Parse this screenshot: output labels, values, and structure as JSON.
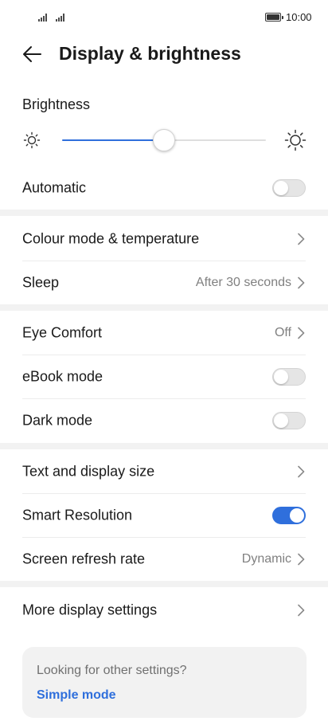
{
  "status_bar": {
    "time": "10:00"
  },
  "header": {
    "title": "Display & brightness"
  },
  "brightness": {
    "label": "Brightness",
    "level": 0.5
  },
  "settings": {
    "automatic": {
      "label": "Automatic",
      "enabled": false
    },
    "colour_mode": {
      "label": "Colour mode & temperature"
    },
    "sleep": {
      "label": "Sleep",
      "value": "After 30 seconds"
    },
    "eye_comfort": {
      "label": "Eye Comfort",
      "value": "Off"
    },
    "ebook_mode": {
      "label": "eBook mode",
      "enabled": false
    },
    "dark_mode": {
      "label": "Dark mode",
      "enabled": false
    },
    "text_display_size": {
      "label": "Text and display size"
    },
    "smart_resolution": {
      "label": "Smart Resolution",
      "enabled": true
    },
    "refresh_rate": {
      "label": "Screen refresh rate",
      "value": "Dynamic"
    },
    "more_display": {
      "label": "More display settings"
    }
  },
  "card": {
    "text": "Looking for other settings?",
    "link": "Simple mode"
  },
  "colors": {
    "accent": "#2f6fdc",
    "separator": "#f2f2f2"
  }
}
